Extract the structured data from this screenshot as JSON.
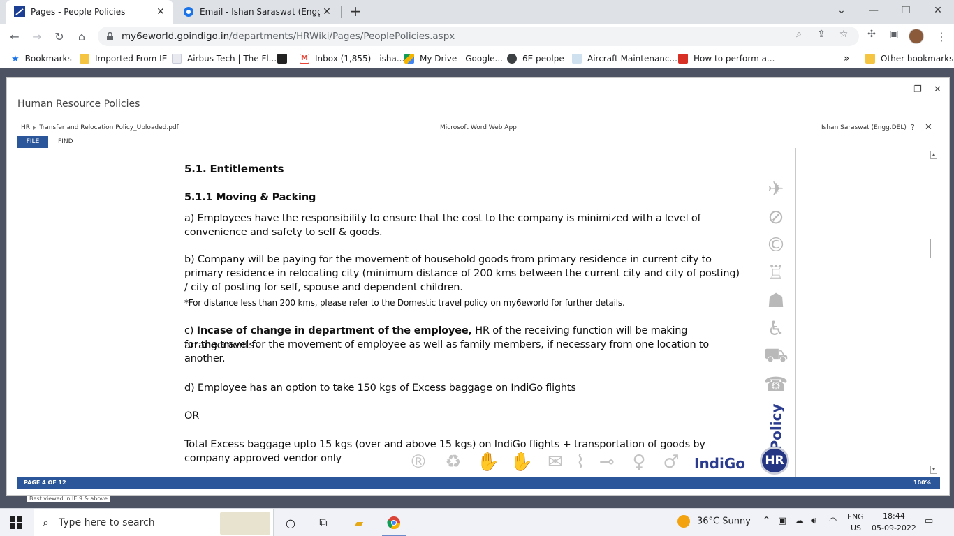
{
  "browser": {
    "tabs": [
      {
        "title": "Pages - People Policies",
        "active": true,
        "favicon": "sharepoint-icon"
      },
      {
        "title": "Email - Ishan Saraswat (Engg,DEL",
        "active": false,
        "favicon": "outlook-icon"
      }
    ],
    "url_host": "my6eworld.goindigo.in",
    "url_path": "/departments/HRWiki/Pages/PeoplePolicies.aspx",
    "bookmarks": [
      {
        "label": "Bookmarks",
        "icon": "star-icon"
      },
      {
        "label": "Imported From IE",
        "icon": "folder-icon"
      },
      {
        "label": "Airbus Tech | The Fl...",
        "icon": "airbus-icon"
      },
      {
        "label": "",
        "icon": "dark-site-icon"
      },
      {
        "label": "Inbox (1,855) - isha...",
        "icon": "gmail-icon"
      },
      {
        "label": "My Drive - Google...",
        "icon": "drive-icon"
      },
      {
        "label": "6E peolpe",
        "icon": "globe-icon"
      },
      {
        "label": "Aircraft Maintenanc...",
        "icon": "page-icon"
      },
      {
        "label": "How to perform a...",
        "icon": "video-icon"
      }
    ],
    "overflow": "»",
    "other_bookmarks": "Other bookmarks"
  },
  "modal": {
    "title": "Human Resource Policies",
    "breadcrumb_root": "HR",
    "breadcrumb_file": "Transfer and Relocation Policy_Uploaded.pdf",
    "app_name": "Microsoft Word Web App",
    "user": "Ishan Saraswat (Engg.DEL)",
    "help": "?",
    "ribbon_file": "FILE",
    "ribbon_find": "FIND",
    "status_page": "PAGE 4 OF 12",
    "status_zoom": "100%"
  },
  "document": {
    "heading": "5.1. Entitlements",
    "subheading": "5.1.1 Moving & Packing",
    "a_line1": "a) Employees have the responsibility to ensure that the cost to the company is minimized with a level of",
    "a_line2": "convenience and safety to self & goods.",
    "b_line1": "b) Company will be paying for the movement of household goods from primary residence in current city to",
    "b_line2": "primary residence in relocating city (minimum distance of 200 kms between the current city and city of posting)",
    "b_line3": "/ city of posting for self, spouse and dependent children.",
    "b_note": "*For distance less than 200 kms, please refer to the Domestic travel policy on my6eworld for further details.",
    "c_prefix": "c) ",
    "c_bold": "Incase of change in department of the employee,",
    "c_rest": " HR of the receiving function will be making arrangements",
    "c_line2": "for the travel for the movement of employee as well as family members, if necessary from one location to",
    "c_line3": "another.",
    "d_line1": "d) Employee has an option to take 150 kgs of Excess baggage on IndiGo flights",
    "or": "OR",
    "total_line1": "Total Excess baggage upto 15 kgs (over and above 15 kgs) on IndiGo flights + transportation of goods by",
    "total_line2": "company approved vendor only",
    "policy_vertical": "Policy",
    "hr_badge": "HR",
    "brand": "IndiGo"
  },
  "page_footer_note": "Best viewed in IE 9 & above",
  "taskbar": {
    "search_placeholder": "Type here to search",
    "weather": "36°C  Sunny",
    "lang_top": "ENG",
    "lang_bottom": "US",
    "time": "18:44",
    "date": "05-09-2022"
  }
}
